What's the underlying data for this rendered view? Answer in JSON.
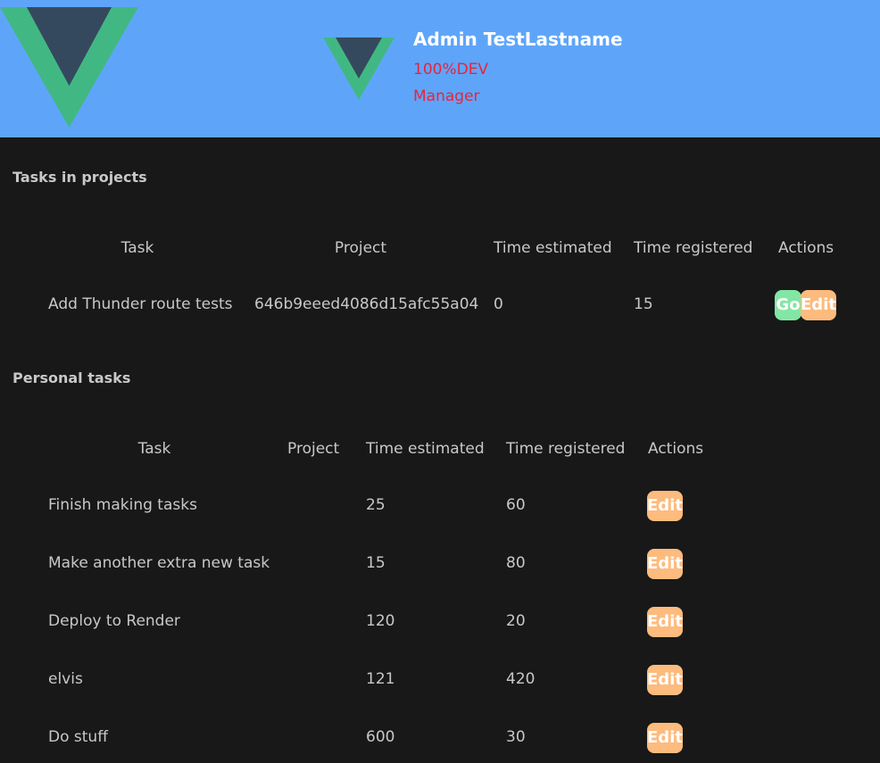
{
  "colors": {
    "header_bg": "#5ea5fa",
    "page_bg": "#181818",
    "accent_red": "#e8243a",
    "go_button": "#82e6a4",
    "edit_button": "#fdbb7e",
    "logo_green": "#41b883",
    "logo_dark": "#35495e"
  },
  "header": {
    "logo_icon": "vue-logo-icon",
    "user": {
      "name": "Admin TestLastname",
      "company": "100%DEV",
      "role": "Manager"
    }
  },
  "project_tasks": {
    "title": "Tasks in projects",
    "columns": [
      "Task",
      "Project",
      "Time estimated",
      "Time registered",
      "Actions"
    ],
    "rows": [
      {
        "task": "Add Thunder route tests",
        "project": "646b9eeed4086d15afc55a04",
        "time_estimated": "0",
        "time_registered": "15",
        "go_label": "Go",
        "edit_label": "Edit"
      }
    ]
  },
  "personal_tasks": {
    "title": "Personal tasks",
    "columns": [
      "Task",
      "Project",
      "Time estimated",
      "Time registered",
      "Actions"
    ],
    "rows": [
      {
        "task": "Finish making tasks",
        "project": "",
        "time_estimated": "25",
        "time_registered": "60",
        "edit_label": "Edit"
      },
      {
        "task": "Make another extra new task",
        "project": "",
        "time_estimated": "15",
        "time_registered": "80",
        "edit_label": "Edit"
      },
      {
        "task": "Deploy to Render",
        "project": "",
        "time_estimated": "120",
        "time_registered": "20",
        "edit_label": "Edit"
      },
      {
        "task": "elvis",
        "project": "",
        "time_estimated": "121",
        "time_registered": "420",
        "edit_label": "Edit"
      },
      {
        "task": "Do stuff",
        "project": "",
        "time_estimated": "600",
        "time_registered": "30",
        "edit_label": "Edit"
      }
    ]
  }
}
